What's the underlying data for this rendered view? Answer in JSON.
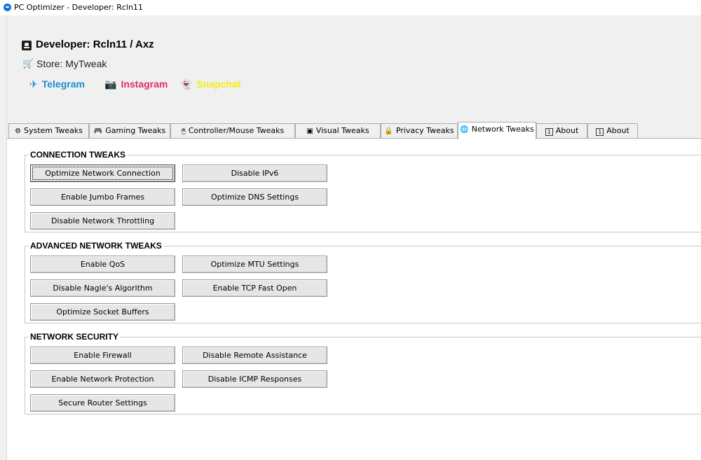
{
  "window": {
    "title": "PC Optimizer - Developer: Rcln11"
  },
  "header": {
    "developer": "Developer: Rcln11 / Axz",
    "store": "Store: MyTweak",
    "socials": [
      {
        "glyph": "✈",
        "label": "Telegram",
        "color": "#1a8ed1"
      },
      {
        "glyph": "📷",
        "label": "Instagram",
        "color": "#e12d6b"
      },
      {
        "glyph": "👻",
        "label": "Snapchat",
        "color": "#f5ed0d"
      }
    ]
  },
  "tabs": [
    {
      "icon": "⚙",
      "label": "System Tweaks"
    },
    {
      "icon": "🎮",
      "label": "Gaming Tweaks"
    },
    {
      "icon": "🖱",
      "label": "Controller/Mouse Tweaks"
    },
    {
      "icon": "▣",
      "label": "Visual Tweaks"
    },
    {
      "icon": "🔒",
      "label": "Privacy Tweaks"
    },
    {
      "icon": "🌐",
      "label": "Network Tweaks"
    },
    {
      "icon": "1",
      "label": "About"
    },
    {
      "icon": "1",
      "label": "About"
    }
  ],
  "active_tab": "Network Tweaks",
  "groups": [
    {
      "title": "CONNECTION TWEAKS",
      "buttons": [
        "Optimize Network Connection",
        "Disable IPv6",
        "Enable Jumbo Frames",
        "Optimize DNS Settings",
        "Disable Network Throttling"
      ]
    },
    {
      "title": "ADVANCED NETWORK TWEAKS",
      "buttons": [
        "Enable QoS",
        "Optimize MTU Settings",
        "Disable Nagle's Algorithm",
        "Enable TCP Fast Open",
        "Optimize Socket Buffers"
      ]
    },
    {
      "title": "NETWORK SECURITY",
      "buttons": [
        "Enable Firewall",
        "Disable Remote Assistance",
        "Enable Network Protection",
        "Disable ICMP Responses",
        "Secure Router Settings"
      ]
    }
  ]
}
